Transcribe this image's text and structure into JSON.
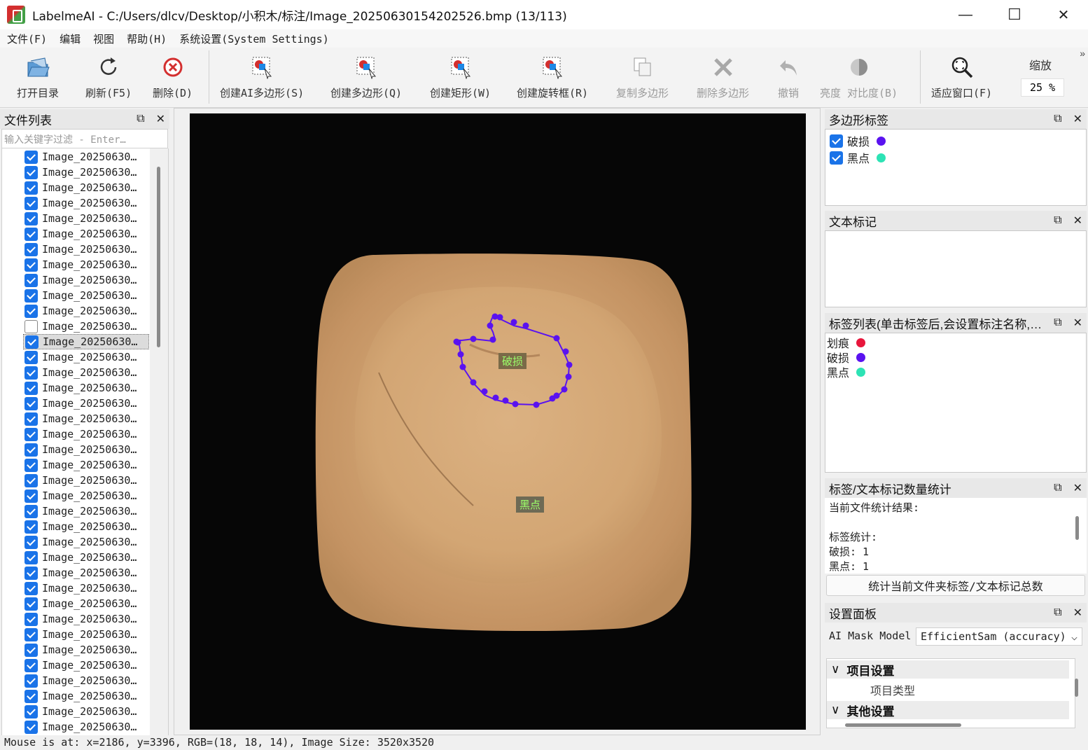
{
  "window": {
    "app_name": "LabelmeAI",
    "title": "LabelmeAI - C:/Users/dlcv/Desktop/小积木/标注/Image_20250630154202526.bmp (13/113)",
    "minimize": "—",
    "maximize": "☐",
    "close": "✕"
  },
  "menu": [
    "文件(F)",
    "编辑",
    "视图",
    "帮助(H)",
    "系统设置(System Settings)"
  ],
  "toolbar": {
    "open_dir": "打开目录",
    "refresh": "刷新(F5)",
    "delete": "删除(D)",
    "create_ai_polygon": "创建AI多边形(S)",
    "create_polygon": "创建多边形(Q)",
    "create_rect": "创建矩形(W)",
    "create_rotated": "创建旋转框(R)",
    "copy_polygon": "复制多边形",
    "delete_polygon": "删除多边形",
    "undo": "撤销",
    "brightness": "亮度 对比度(B)",
    "fit_window": "适应窗口(F)",
    "zoom_label": "缩放",
    "zoom_value": "25 %",
    "more": "»"
  },
  "file_panel": {
    "title": "文件列表",
    "filter_placeholder": "输入关键字过滤 - Enter…",
    "items": [
      {
        "name": "Image_20250630…",
        "checked": true
      },
      {
        "name": "Image_20250630…",
        "checked": true
      },
      {
        "name": "Image_20250630…",
        "checked": true
      },
      {
        "name": "Image_20250630…",
        "checked": true
      },
      {
        "name": "Image_20250630…",
        "checked": true
      },
      {
        "name": "Image_20250630…",
        "checked": true
      },
      {
        "name": "Image_20250630…",
        "checked": true
      },
      {
        "name": "Image_20250630…",
        "checked": true
      },
      {
        "name": "Image_20250630…",
        "checked": true
      },
      {
        "name": "Image_20250630…",
        "checked": true
      },
      {
        "name": "Image_20250630…",
        "checked": true
      },
      {
        "name": "Image_20250630…",
        "checked": false
      },
      {
        "name": "Image_20250630…",
        "checked": true,
        "selected": true
      },
      {
        "name": "Image_20250630…",
        "checked": true
      },
      {
        "name": "Image_20250630…",
        "checked": true
      },
      {
        "name": "Image_20250630…",
        "checked": true
      },
      {
        "name": "Image_20250630…",
        "checked": true
      },
      {
        "name": "Image_20250630…",
        "checked": true
      },
      {
        "name": "Image_20250630…",
        "checked": true
      },
      {
        "name": "Image_20250630…",
        "checked": true
      },
      {
        "name": "Image_20250630…",
        "checked": true
      },
      {
        "name": "Image_20250630…",
        "checked": true
      },
      {
        "name": "Image_20250630…",
        "checked": true
      },
      {
        "name": "Image_20250630…",
        "checked": true
      },
      {
        "name": "Image_20250630…",
        "checked": true
      },
      {
        "name": "Image_20250630…",
        "checked": true
      },
      {
        "name": "Image_20250630…",
        "checked": true
      },
      {
        "name": "Image_20250630…",
        "checked": true
      },
      {
        "name": "Image_20250630…",
        "checked": true
      },
      {
        "name": "Image_20250630…",
        "checked": true
      },
      {
        "name": "Image_20250630…",
        "checked": true
      },
      {
        "name": "Image_20250630…",
        "checked": true
      },
      {
        "name": "Image_20250630…",
        "checked": true
      },
      {
        "name": "Image_20250630…",
        "checked": true
      },
      {
        "name": "Image_20250630…",
        "checked": true
      },
      {
        "name": "Image_20250630…",
        "checked": true
      },
      {
        "name": "Image_20250630…",
        "checked": true
      },
      {
        "name": "Image_20250630…",
        "checked": true
      }
    ]
  },
  "canvas": {
    "annotations": [
      {
        "label": "破损",
        "color": "#5a12f0"
      },
      {
        "label": "黑点",
        "color": "#2de3b5"
      }
    ]
  },
  "polygon_labels": {
    "title": "多边形标签",
    "items": [
      {
        "label": "破损",
        "color": "#5a12f0",
        "checked": true
      },
      {
        "label": "黑点",
        "color": "#2de3b5",
        "checked": true
      }
    ]
  },
  "text_marks": {
    "title": "文本标记"
  },
  "label_list": {
    "title": "标签列表(单击标签后,会设置标注名称,…",
    "items": [
      {
        "label": "划痕",
        "color": "#e8163c"
      },
      {
        "label": "破损",
        "color": "#5a12f0"
      },
      {
        "label": "黑点",
        "color": "#2de3b5"
      }
    ]
  },
  "stats": {
    "title": "标签/文本标记数量统计",
    "line1": "当前文件统计结果:",
    "line2": "标签统计:",
    "line3": "破损: 1",
    "line4": "黑点: 1",
    "button": "统计当前文件夹标签/文本标记总数"
  },
  "settings": {
    "title": "设置面板",
    "model_label": "AI Mask Model",
    "model_value": "EfficientSam (accuracy)",
    "section1": "项目设置",
    "section1_child": "项目类型",
    "section2": "其他设置"
  },
  "dock_btns": {
    "float": "⧉",
    "close": "✕"
  },
  "status": "Mouse is at: x=2186, y=3396, RGB=(18, 18, 14), Image Size: 3520x3520"
}
